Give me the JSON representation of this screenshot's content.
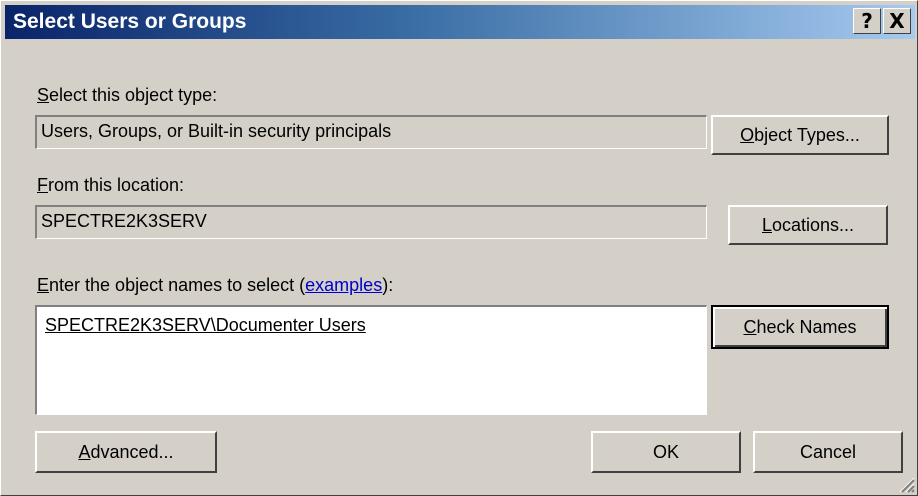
{
  "window": {
    "title": "Select Users or Groups",
    "help_label": "?",
    "close_label": "X"
  },
  "object_type": {
    "label_accel": "S",
    "label_rest": "elect this object type:",
    "value": "Users, Groups, or Built-in security principals",
    "button_accel": "O",
    "button_rest": "bject Types..."
  },
  "location": {
    "label_accel": "F",
    "label_rest": "rom this location:",
    "value": "SPECTRE2K3SERV",
    "button_accel": "L",
    "button_rest": "ocations..."
  },
  "names": {
    "label_accel": "E",
    "label_pre": "nter the object names to select (",
    "label_link": "examples",
    "label_post": "):",
    "value": "SPECTRE2K3SERV\\Documenter Users",
    "check_accel": "C",
    "check_rest": "heck Names"
  },
  "footer": {
    "advanced_accel": "A",
    "advanced_rest": "dvanced...",
    "ok_label": "OK",
    "cancel_label": "Cancel"
  }
}
